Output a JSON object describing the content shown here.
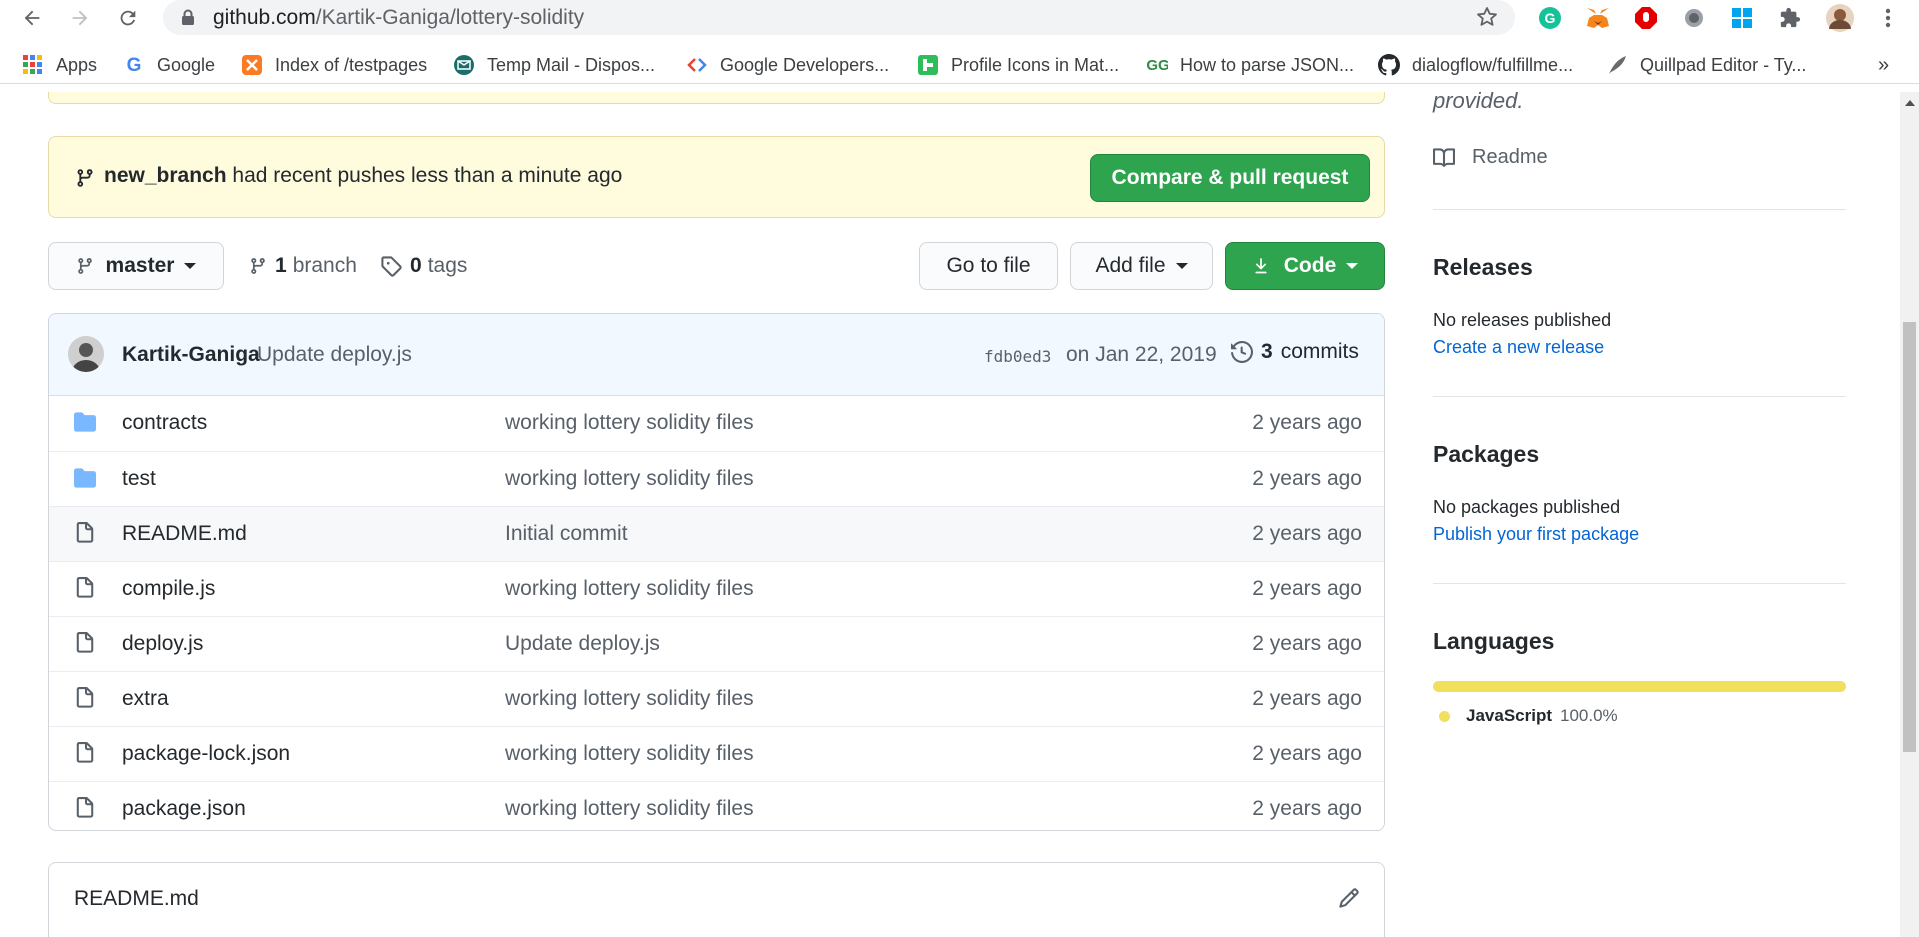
{
  "browser": {
    "url_host": "github.com",
    "url_path": "/Kartik-Ganiga/lottery-solidity",
    "bookmarks": [
      {
        "label": "Apps",
        "icon": "apps-grid-icon"
      },
      {
        "label": "Google",
        "icon": "google-icon"
      },
      {
        "label": "Index of /testpages",
        "icon": "xampp-icon"
      },
      {
        "label": "Temp Mail - Dispos...",
        "icon": "tempmail-icon"
      },
      {
        "label": "Google Developers...",
        "icon": "google-developers-icon"
      },
      {
        "label": "Profile Icons in Mat...",
        "icon": "profile-icons-icon"
      },
      {
        "label": "How to parse JSON...",
        "icon": "geeksforgeeks-icon"
      },
      {
        "label": "dialogflow/fulfillme...",
        "icon": "github-icon"
      },
      {
        "label": "Quillpad Editor - Ty...",
        "icon": "quill-icon"
      }
    ],
    "more_bookmarks": "»"
  },
  "push_banner": {
    "branch": "new_branch",
    "message": "had recent pushes less than a minute ago",
    "button": "Compare & pull request"
  },
  "repo_nav": {
    "branch_select": "master",
    "branch_count": "1",
    "branch_label": "branch",
    "tag_count": "0",
    "tag_label": "tags",
    "go_to_file": "Go to file",
    "add_file": "Add file",
    "code": "Code"
  },
  "latest_commit": {
    "author": "Kartik-Ganiga",
    "message": "Update deploy.js",
    "sha": "fdb0ed3",
    "date": "on Jan 22, 2019",
    "commit_count": "3",
    "commit_label": "commits"
  },
  "files": [
    {
      "type": "dir",
      "name": "contracts",
      "message": "working lottery solidity files",
      "age": "2 years ago"
    },
    {
      "type": "dir",
      "name": "test",
      "message": "working lottery solidity files",
      "age": "2 years ago"
    },
    {
      "type": "file",
      "name": "README.md",
      "message": "Initial commit",
      "age": "2 years ago"
    },
    {
      "type": "file",
      "name": "compile.js",
      "message": "working lottery solidity files",
      "age": "2 years ago"
    },
    {
      "type": "file",
      "name": "deploy.js",
      "message": "Update deploy.js",
      "age": "2 years ago"
    },
    {
      "type": "file",
      "name": "extra",
      "message": "working lottery solidity files",
      "age": "2 years ago"
    },
    {
      "type": "file",
      "name": "package-lock.json",
      "message": "working lottery solidity files",
      "age": "2 years ago"
    },
    {
      "type": "file",
      "name": "package.json",
      "message": "working lottery solidity files",
      "age": "2 years ago"
    }
  ],
  "readme_box": {
    "title": "README.md"
  },
  "sidebar": {
    "about_tail": "provided.",
    "readme_link": "Readme",
    "releases_heading": "Releases",
    "releases_text": "No releases published",
    "releases_link": "Create a new release",
    "packages_heading": "Packages",
    "packages_text": "No packages published",
    "packages_link": "Publish your first package",
    "languages_heading": "Languages",
    "language_name": "JavaScript",
    "language_percent": "100.0%",
    "language_color": "#f1e05a"
  }
}
